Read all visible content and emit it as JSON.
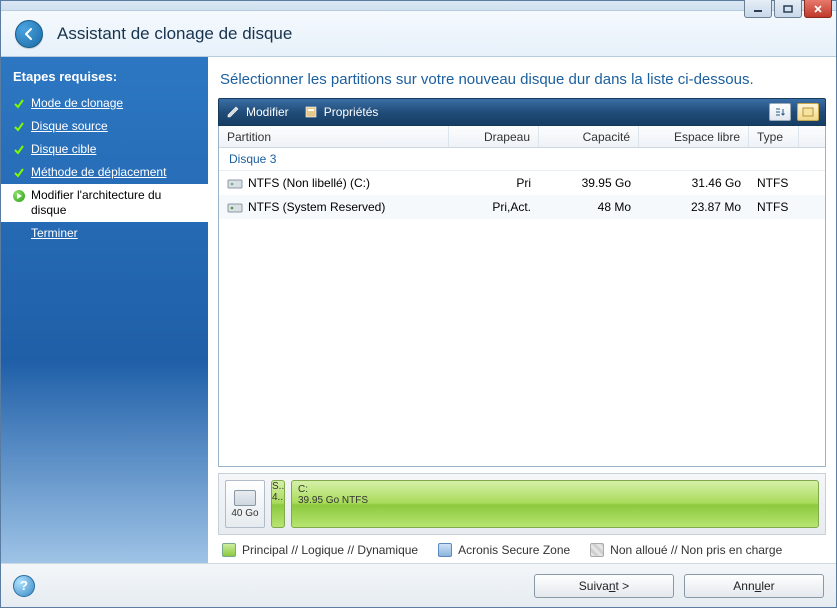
{
  "window": {
    "title": "Assistant de clonage de disque"
  },
  "sidebar": {
    "heading": "Etapes requises:",
    "steps": [
      {
        "label": "Mode de clonage",
        "state": "done"
      },
      {
        "label": "Disque source",
        "state": "done"
      },
      {
        "label": "Disque cible",
        "state": "done"
      },
      {
        "label": "Méthode de déplacement",
        "state": "done"
      },
      {
        "label": "Modifier l'architecture du disque",
        "state": "current"
      },
      {
        "label": "Terminer",
        "state": "pending"
      }
    ]
  },
  "instruction": "Sélectionner les partitions sur votre nouveau disque dur dans la liste ci-dessous.",
  "toolbar": {
    "modify": "Modifier",
    "properties": "Propriétés"
  },
  "columns": {
    "partition": "Partition",
    "flags": "Drapeau",
    "capacity": "Capacité",
    "free": "Espace libre",
    "type": "Type"
  },
  "disk_group": "Disque 3",
  "rows": [
    {
      "name": "NTFS (Non libellé) (C:)",
      "flags": "Pri",
      "capacity": "39.95 Go",
      "free": "31.46 Go",
      "type": "NTFS"
    },
    {
      "name": "NTFS (System Reserved)",
      "flags": "Pri,Act.",
      "capacity": "48 Mo",
      "free": "23.87 Mo",
      "type": "NTFS"
    }
  ],
  "diskmap": {
    "total": "40 Go",
    "seg_small_line1": "S...",
    "seg_small_line2": "4...",
    "seg_large_line1": "C:",
    "seg_large_line2": "39.95 Go  NTFS"
  },
  "legend": {
    "principal": "Principal // Logique // Dynamique",
    "asz": "Acronis Secure Zone",
    "unalloc": "Non alloué // Non pris en charge"
  },
  "footer": {
    "next_prefix": "Suiva",
    "next_u": "n",
    "next_suffix": "t >",
    "cancel_prefix": "Ann",
    "cancel_u": "u",
    "cancel_suffix": "ler"
  }
}
